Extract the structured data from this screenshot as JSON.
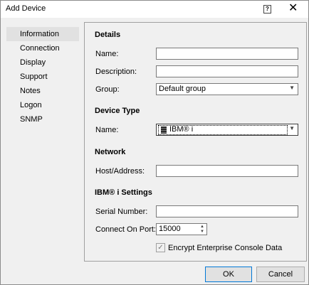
{
  "window": {
    "title": "Add Device",
    "help_label": "?",
    "close_label": "✕"
  },
  "nav": [
    "Information",
    "Connection",
    "Display",
    "Support",
    "Notes",
    "Logon",
    "SNMP"
  ],
  "details": {
    "heading": "Details",
    "name_label": "Name:",
    "name_value": "",
    "description_label": "Description:",
    "description_value": "",
    "group_label": "Group:",
    "group_value": "Default group"
  },
  "device_type": {
    "heading": "Device Type",
    "name_label": "Name:",
    "name_value": "IBM® i"
  },
  "network": {
    "heading": "Network",
    "host_label": "Host/Address:",
    "host_value": ""
  },
  "ibmi": {
    "heading": "IBM® i Settings",
    "serial_label": "Serial Number:",
    "serial_value": "",
    "port_label": "Connect On Port:",
    "port_value": "15000",
    "encrypt_label": "Encrypt Enterprise Console Data",
    "encrypt_checked": true
  },
  "buttons": {
    "ok": "OK",
    "cancel": "Cancel"
  },
  "icons": {
    "device_type": "ibm-server-icon"
  }
}
